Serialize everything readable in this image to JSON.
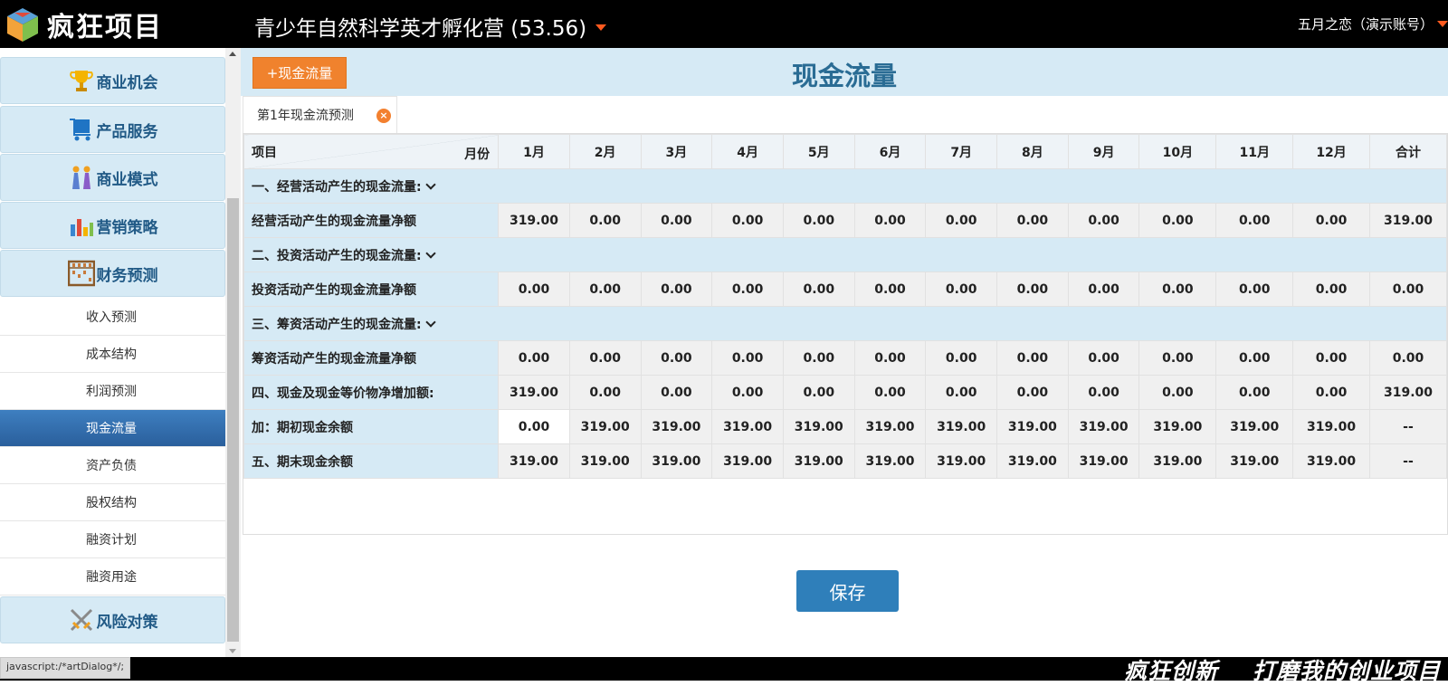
{
  "header": {
    "logo_text": "疯狂项目",
    "project_title": "青少年自然科学英才孵化营 (53.56)",
    "user": "五月之恋（演示账号）"
  },
  "sidebar": {
    "categories": [
      {
        "label": "商业机会",
        "icon": "trophy-icon"
      },
      {
        "label": "产品服务",
        "icon": "cart-icon"
      },
      {
        "label": "商业模式",
        "icon": "people-icon"
      },
      {
        "label": "营销策略",
        "icon": "bar-chart-icon"
      },
      {
        "label": "财务预测",
        "icon": "abacus-icon"
      },
      {
        "label": "风险对策",
        "icon": "crossed-swords-icon"
      }
    ],
    "sub_items": [
      "收入预测",
      "成本结构",
      "利润预测",
      "现金流量",
      "资产负债",
      "股权结构",
      "融资计划",
      "融资用途"
    ],
    "active_sub_item": "现金流量"
  },
  "main": {
    "add_button": "+现金流量",
    "page_title": "现金流量",
    "tab_label": "第1年现金流预测",
    "tab_close": "×",
    "save_label": "保存"
  },
  "table": {
    "item_header": "项目",
    "month_header": "月份",
    "columns": [
      "1月",
      "2月",
      "3月",
      "4月",
      "5月",
      "6月",
      "7月",
      "8月",
      "9月",
      "10月",
      "11月",
      "12月",
      "合计"
    ],
    "sections": {
      "operating": "一、经营活动产生的现金流量:",
      "investing": "二、投资活动产生的现金流量:",
      "financing": "三、筹资活动产生的现金流量:"
    },
    "rows": {
      "operating_net": {
        "label": "经营活动产生的现金流量净额",
        "values": [
          "319.00",
          "0.00",
          "0.00",
          "0.00",
          "0.00",
          "0.00",
          "0.00",
          "0.00",
          "0.00",
          "0.00",
          "0.00",
          "0.00",
          "319.00"
        ]
      },
      "investing_net": {
        "label": "投资活动产生的现金流量净额",
        "values": [
          "0.00",
          "0.00",
          "0.00",
          "0.00",
          "0.00",
          "0.00",
          "0.00",
          "0.00",
          "0.00",
          "0.00",
          "0.00",
          "0.00",
          "0.00"
        ]
      },
      "financing_net": {
        "label": "筹资活动产生的现金流量净额",
        "values": [
          "0.00",
          "0.00",
          "0.00",
          "0.00",
          "0.00",
          "0.00",
          "0.00",
          "0.00",
          "0.00",
          "0.00",
          "0.00",
          "0.00",
          "0.00"
        ]
      },
      "net_increase": {
        "label": "四、现金及现金等价物净增加额:",
        "values": [
          "319.00",
          "0.00",
          "0.00",
          "0.00",
          "0.00",
          "0.00",
          "0.00",
          "0.00",
          "0.00",
          "0.00",
          "0.00",
          "0.00",
          "319.00"
        ]
      },
      "opening_balance": {
        "label": "加：期初现金余额",
        "values": [
          "0.00",
          "319.00",
          "319.00",
          "319.00",
          "319.00",
          "319.00",
          "319.00",
          "319.00",
          "319.00",
          "319.00",
          "319.00",
          "319.00",
          "--"
        ]
      },
      "closing_balance": {
        "label": "五、期末现金余额",
        "values": [
          "319.00",
          "319.00",
          "319.00",
          "319.00",
          "319.00",
          "319.00",
          "319.00",
          "319.00",
          "319.00",
          "319.00",
          "319.00",
          "319.00",
          "--"
        ]
      }
    }
  },
  "footer": {
    "status_url": "javascript:/*artDialog*/;",
    "slogan_1": "疯狂创新",
    "slogan_2": "打磨我的创业项目"
  },
  "colors": {
    "accent_orange": "#f0822d",
    "light_blue": "#d6eaf5",
    "title_blue": "#2a6c94",
    "active_nav": "#2a5f9c",
    "save_blue": "#2f7fba"
  }
}
